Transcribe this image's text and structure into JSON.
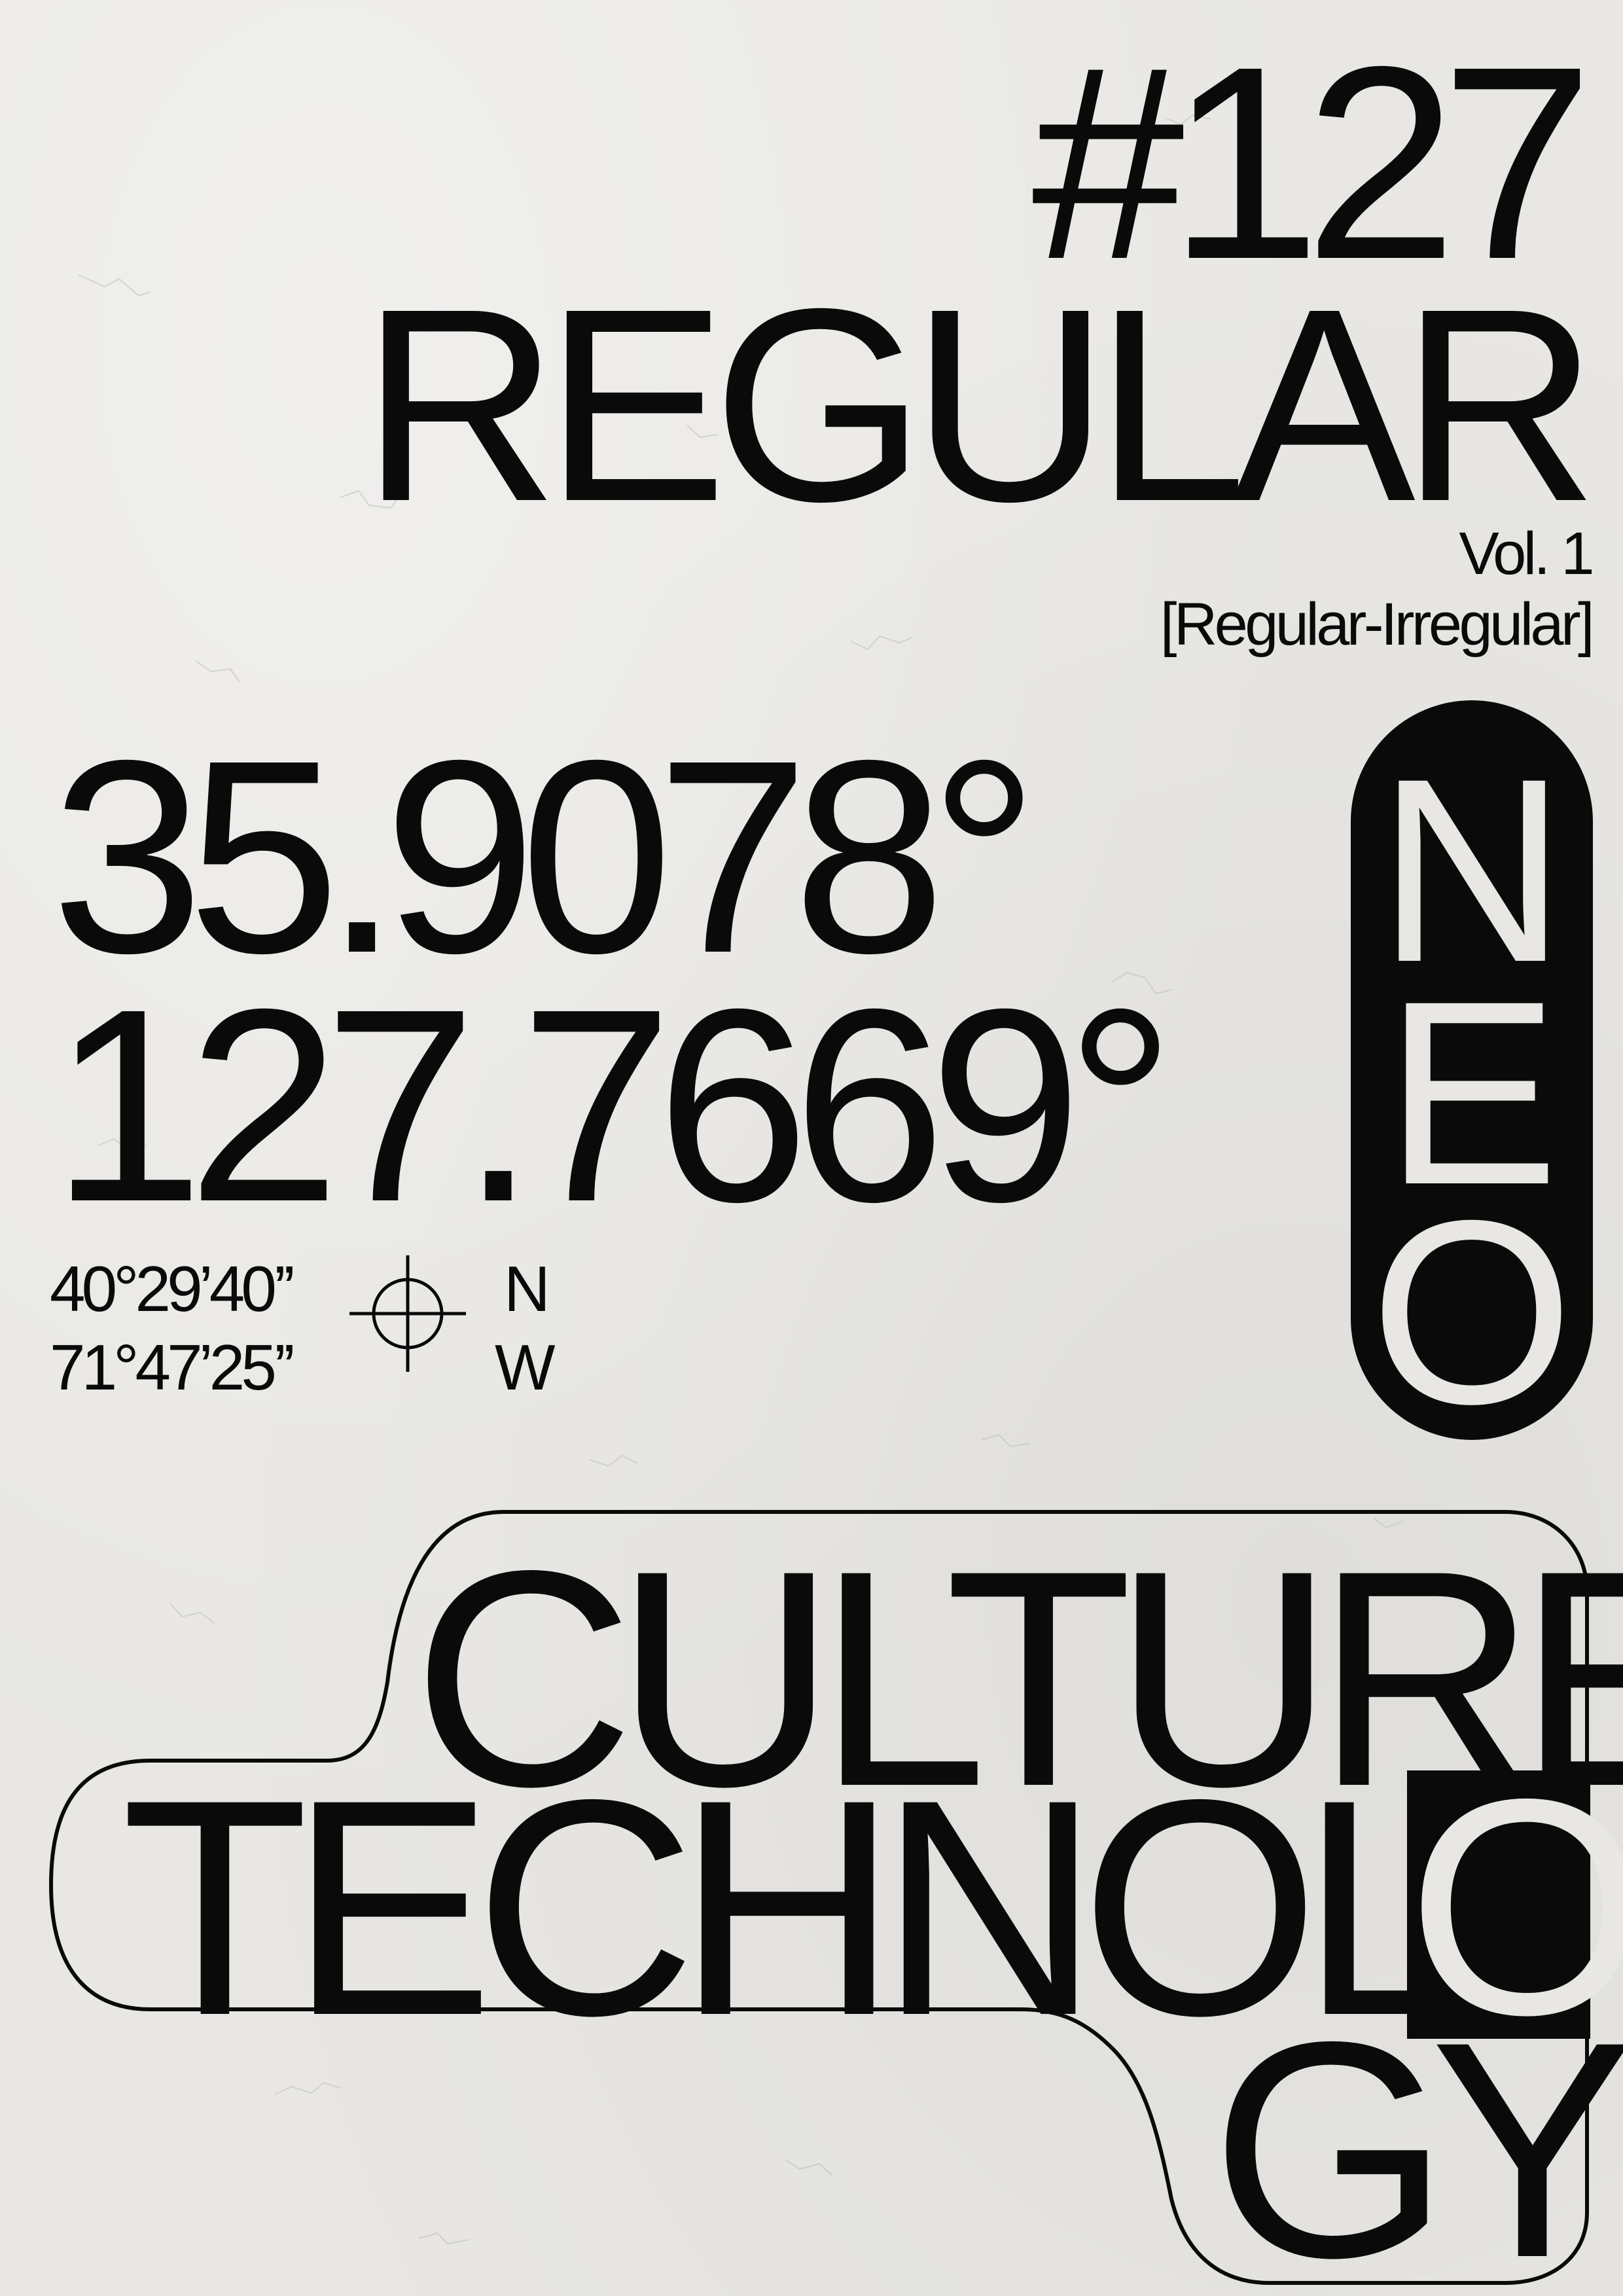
{
  "header": {
    "issue": "#127",
    "title": "REGULAR",
    "volume": "Vol. 1",
    "subtitle": "[Regular-Irregular]"
  },
  "coordinates": {
    "decimal_latitude": "35.9078°",
    "decimal_longitude": "127.7669°",
    "dms_latitude": "40°29’40’’",
    "dms_longitude": "71°47’25’’",
    "dir_latitude": "N",
    "dir_longitude": "W"
  },
  "vertical_word": {
    "letters": [
      "N",
      "E",
      "O"
    ]
  },
  "headline": {
    "line1": "CULTURE",
    "line2": "TECHNOL",
    "highlight_letter": "O",
    "line3": "GY"
  },
  "icons": {
    "crosshair": "crosshair-icon"
  },
  "colors": {
    "ink": "#0a0a0a",
    "paper": "#e8e7e3"
  }
}
